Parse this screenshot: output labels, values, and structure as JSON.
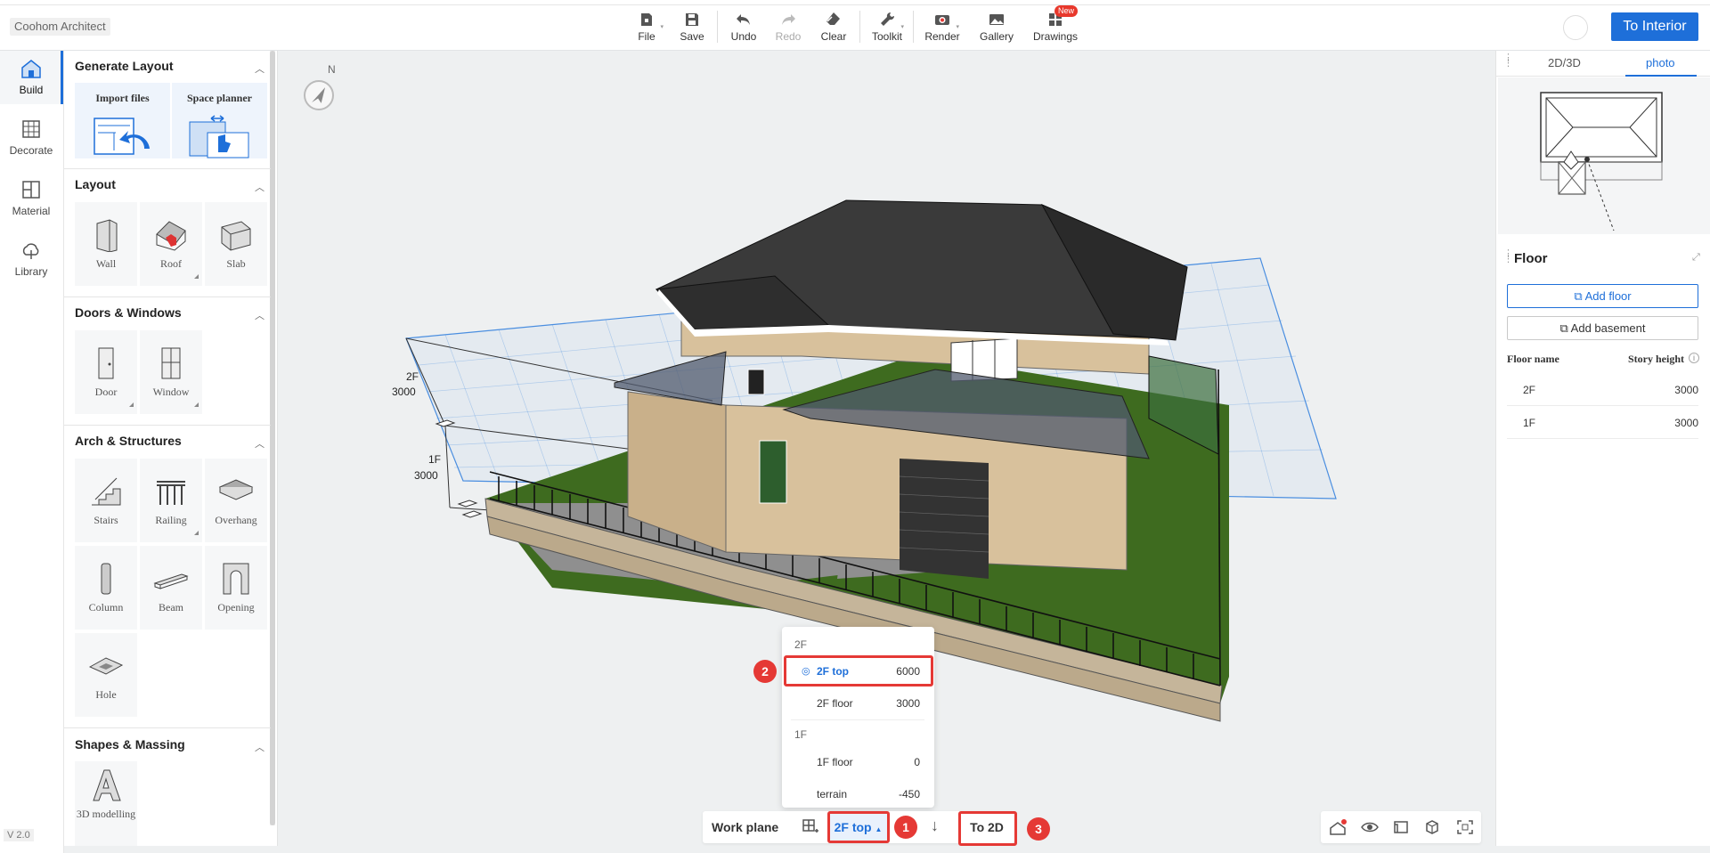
{
  "app": {
    "name": "Coohom Architect",
    "version": "V 2.0",
    "cta": "To Interior"
  },
  "toolbar": {
    "file": "File",
    "save": "Save",
    "undo": "Undo",
    "redo": "Redo",
    "clear": "Clear",
    "toolkit": "Toolkit",
    "render": "Render",
    "gallery": "Gallery",
    "drawings": "Drawings",
    "new_badge": "New"
  },
  "rail": {
    "build": "Build",
    "decorate": "Decorate",
    "material": "Material",
    "library": "Library"
  },
  "panel": {
    "generate_layout": {
      "title": "Generate Layout",
      "import": "Import files",
      "planner": "Space planner"
    },
    "layout": {
      "title": "Layout",
      "items": [
        "Wall",
        "Roof",
        "Slab"
      ]
    },
    "doors": {
      "title": "Doors & Windows",
      "items": [
        "Door",
        "Window"
      ]
    },
    "arch": {
      "title": "Arch & Structures",
      "items": [
        "Stairs",
        "Railing",
        "Overhang",
        "Column",
        "Beam",
        "Opening",
        "Hole"
      ]
    },
    "shapes": {
      "title": "Shapes & Massing",
      "item": "3D modelling"
    }
  },
  "compass": {
    "north": "N"
  },
  "scene": {
    "level_2f_name": "2F",
    "level_2f_height": "3000",
    "level_1f_name": "1F",
    "level_1f_height": "3000"
  },
  "work_plane_menu": {
    "group_2f": "2F",
    "group_1f": "1F",
    "rows": [
      {
        "name": "2F top",
        "value": "6000",
        "selected": true
      },
      {
        "name": "2F floor",
        "value": "3000"
      },
      {
        "name": "1F floor",
        "value": "0"
      },
      {
        "name": "terrain",
        "value": "-450"
      }
    ]
  },
  "bottombar": {
    "work_plane": "Work plane",
    "current_plane": "2F top",
    "to_2d": "To 2D"
  },
  "callouts": [
    "1",
    "2",
    "3"
  ],
  "right": {
    "tab_2d3d": "2D/3D",
    "tab_photo": "photo",
    "floor_title": "Floor",
    "add_floor": "Add floor",
    "add_basement": "Add basement",
    "col_name": "Floor name",
    "col_height": "Story height",
    "floors": [
      {
        "name": "2F",
        "height": "3000"
      },
      {
        "name": "1F",
        "height": "3000"
      }
    ]
  },
  "colors": {
    "accent": "#1e6fd9",
    "highlight": "#e53935"
  }
}
